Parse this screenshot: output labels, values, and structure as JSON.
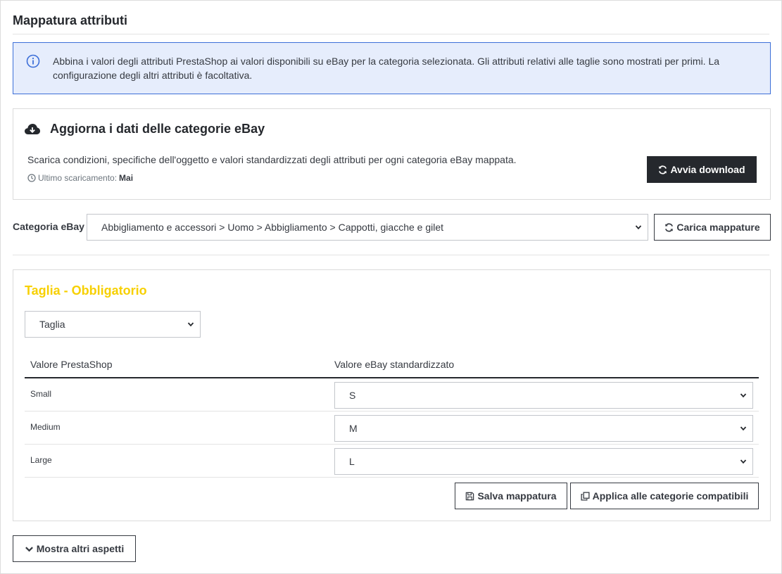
{
  "page": {
    "title": "Mappatura attributi"
  },
  "alert": {
    "text": "Abbina i valori degli attributi PrestaShop ai valori disponibili su eBay per la categoria selezionata. Gli attributi relativi alle taglie sono mostrati per primi. La configurazione degli altri attributi è facoltativa."
  },
  "refresh_card": {
    "title": "Aggiorna i dati delle categorie eBay",
    "description": "Scarica condizioni, specifiche dell'oggetto e valori standardizzati degli attributi per ogni categoria eBay mappata.",
    "last_download_label": "Ultimo scaricamento:",
    "last_download_value": "Mai",
    "download_button": "Avvia download"
  },
  "category": {
    "label": "Categoria eBay",
    "selected": "Abbigliamento e accessori > Uomo > Abbigliamento > Cappotti, giacche e gilet",
    "load_button": "Carica mappature"
  },
  "attribute_section": {
    "title": "Taglia - Obbligatorio",
    "attribute_selected": "Taglia",
    "columns": [
      "Valore PrestaShop",
      "Valore eBay standardizzato"
    ],
    "rows": [
      {
        "prestashop": "Small",
        "ebay": "S"
      },
      {
        "prestashop": "Medium",
        "ebay": "M"
      },
      {
        "prestashop": "Large",
        "ebay": "L"
      }
    ],
    "save_button": "Salva mappatura",
    "apply_button": "Applica alle categorie compatibili"
  },
  "more_button": "Mostra altri aspetti",
  "colors": {
    "accent_yellow": "#f7d000",
    "info_bg": "#e6edfc",
    "info_border": "#3d6fd8",
    "dark_button": "#25282d"
  },
  "icons": {
    "info": "info-circle-icon",
    "cloud": "cloud-download-icon",
    "clock": "clock-icon",
    "refresh": "refresh-icon",
    "save": "save-icon",
    "copy": "copy-icon",
    "chevron": "chevron-down-icon"
  }
}
